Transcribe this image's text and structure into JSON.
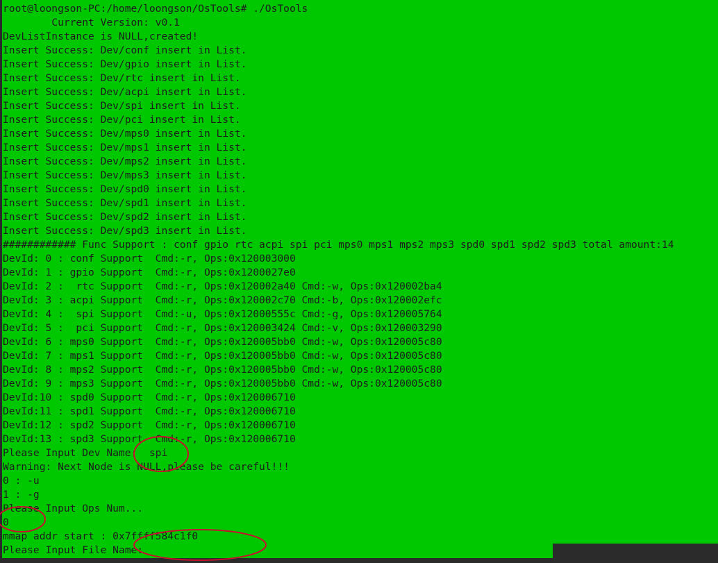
{
  "terminal": {
    "background_color": "#00c800",
    "text_color": "#1d1d1d",
    "annotation_color": "#c8102e",
    "lines": [
      "root@loongson-PC:/home/loongson/OsTools# ./OsTools",
      "        Current Version: v0.1",
      "DevListInstance is NULL,created!",
      "Insert Success: Dev/conf insert in List.",
      "Insert Success: Dev/gpio insert in List.",
      "Insert Success: Dev/rtc insert in List.",
      "Insert Success: Dev/acpi insert in List.",
      "Insert Success: Dev/spi insert in List.",
      "Insert Success: Dev/pci insert in List.",
      "Insert Success: Dev/mps0 insert in List.",
      "Insert Success: Dev/mps1 insert in List.",
      "Insert Success: Dev/mps2 insert in List.",
      "Insert Success: Dev/mps3 insert in List.",
      "Insert Success: Dev/spd0 insert in List.",
      "Insert Success: Dev/spd1 insert in List.",
      "Insert Success: Dev/spd2 insert in List.",
      "Insert Success: Dev/spd3 insert in List.",
      "############ Func Support : conf gpio rtc acpi spi pci mps0 mps1 mps2 mps3 spd0 spd1 spd2 spd3 total amount:14",
      "DevId: 0 : conf Support  Cmd:-r, Ops:0x120003000",
      "DevId: 1 : gpio Support  Cmd:-r, Ops:0x1200027e0",
      "DevId: 2 :  rtc Support  Cmd:-r, Ops:0x120002a40 Cmd:-w, Ops:0x120002ba4",
      "DevId: 3 : acpi Support  Cmd:-r, Ops:0x120002c70 Cmd:-b, Ops:0x120002efc",
      "DevId: 4 :  spi Support  Cmd:-u, Ops:0x12000555c Cmd:-g, Ops:0x120005764",
      "DevId: 5 :  pci Support  Cmd:-r, Ops:0x120003424 Cmd:-v, Ops:0x120003290",
      "DevId: 6 : mps0 Support  Cmd:-r, Ops:0x120005bb0 Cmd:-w, Ops:0x120005c80",
      "DevId: 7 : mps1 Support  Cmd:-r, Ops:0x120005bb0 Cmd:-w, Ops:0x120005c80",
      "DevId: 8 : mps2 Support  Cmd:-r, Ops:0x120005bb0 Cmd:-w, Ops:0x120005c80",
      "DevId: 9 : mps3 Support  Cmd:-r, Ops:0x120005bb0 Cmd:-w, Ops:0x120005c80",
      "DevId:10 : spd0 Support  Cmd:-r, Ops:0x120006710",
      "DevId:11 : spd1 Support  Cmd:-r, Ops:0x120006710",
      "DevId:12 : spd2 Support  Cmd:-r, Ops:0x120006710",
      "DevId:13 : spd3 Support  Cmd:-r, Ops:0x120006710",
      "Please Input Dev Name:  spi",
      "Warning: Next Node is NULL,please be careful!!!",
      "0 : -u",
      "1 : -g",
      "Please Input Ops Num...",
      "0",
      "mmap addr start : 0x7ffff584c1f0",
      "Please Input File Name:"
    ]
  }
}
